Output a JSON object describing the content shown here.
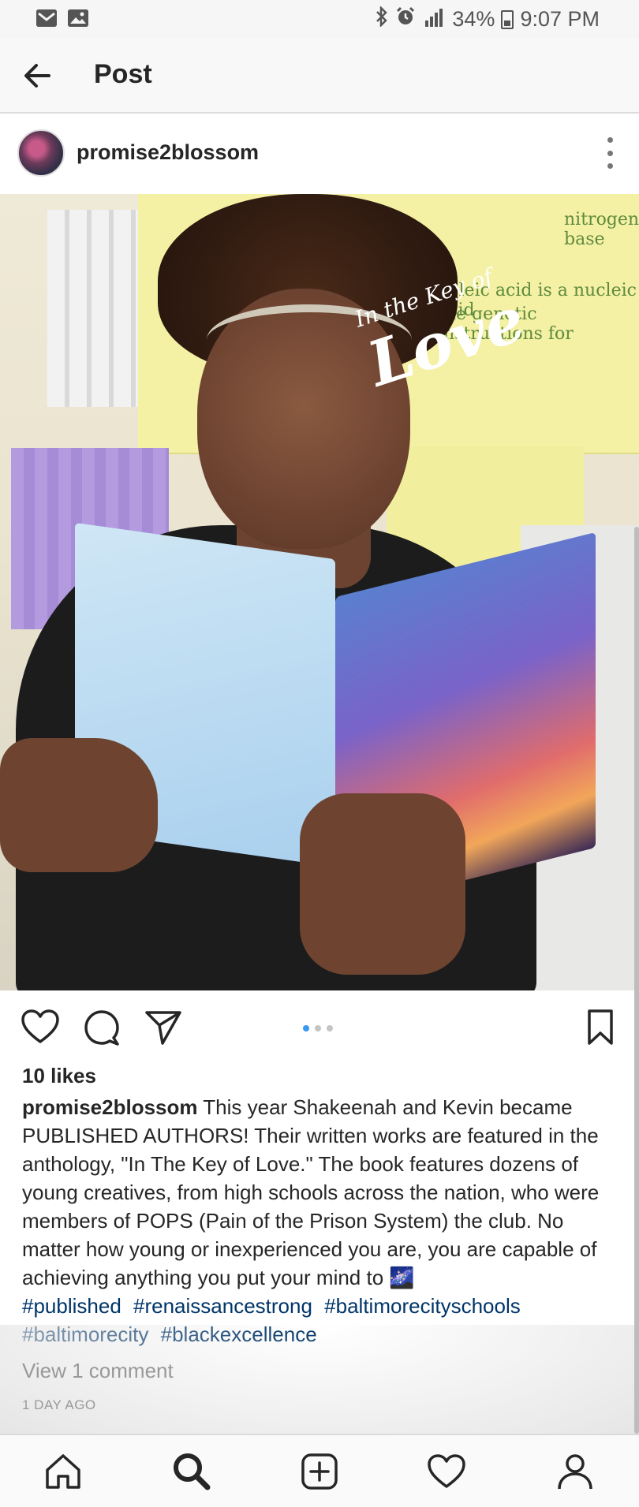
{
  "status_bar": {
    "battery": "34%",
    "time": "9:07 PM",
    "icons": [
      "gmail-icon",
      "gallery-icon",
      "bluetooth-icon",
      "alarm-icon",
      "lte-signal-icon",
      "battery-icon"
    ]
  },
  "header": {
    "title": "Post",
    "back_icon": "back-arrow-icon"
  },
  "post": {
    "author": "promise2blossom",
    "more_icon": "more-vertical-icon",
    "image": {
      "book_title_small": "In the Key of",
      "book_title_large": "Love"
    },
    "carousel": {
      "count": 3,
      "active_index": 0
    },
    "likes": "10 likes",
    "caption_user": "promise2blossom",
    "caption_text": "This year Shakeenah and Kevin became PUBLISHED AUTHORS! Their written works are featured in the anthology, \"In The Key of Love.\" The book features dozens of young creatives, from high schools across the nation, who were members of POPS (Pain of the Prison System) the club. No matter how young or inexperienced you are, you are capable of achieving anything you put your mind to 🌌",
    "hashtags": [
      "#published",
      "#renaissancestrong",
      "#baltimorecityschools",
      "#baltimorecity",
      "#blackexcellence"
    ],
    "view_comments": "View 1 comment",
    "time_ago": "1 DAY AGO"
  },
  "colors": {
    "hashtag": "#003569",
    "active_dot": "#3897f0",
    "muted": "#999999"
  },
  "bottom_nav": [
    "home-icon",
    "search-icon",
    "add-post-icon",
    "activity-heart-icon",
    "profile-icon"
  ]
}
